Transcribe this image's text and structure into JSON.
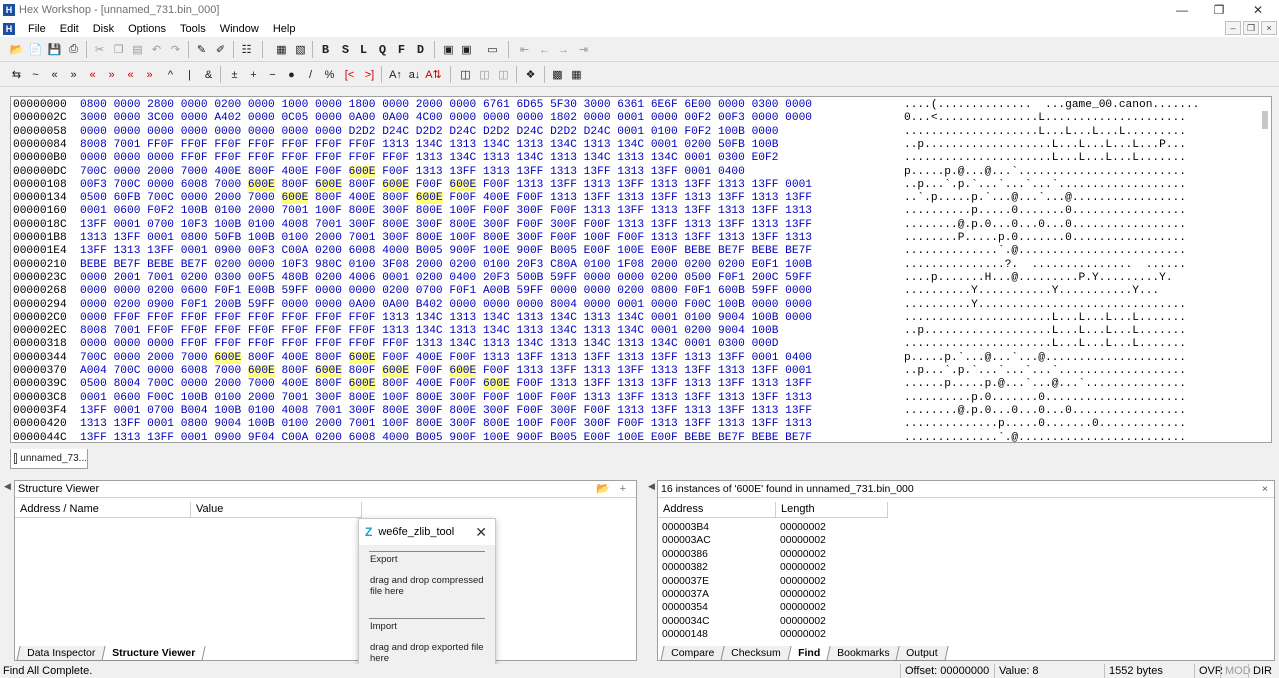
{
  "window": {
    "title": "Hex Workshop - [unnamed_731.bin_000]",
    "app_icon": "H"
  },
  "menu": [
    "File",
    "Edit",
    "Disk",
    "Options",
    "Tools",
    "Window",
    "Help"
  ],
  "toolbar2_letters": [
    "B",
    "S",
    "L",
    "Q",
    "F",
    "D"
  ],
  "hex_rows": [
    {
      "off": "00000000",
      "bytes": "0800 0000 2800 0000 0200 0000 1000 0000 1800 0000 2000 0000 6761 6D65 5F30 3000 6361 6E6F 6E00 0000 0300 0000",
      "ascii": "....(..............  ...game_00.canon.......",
      "hl": []
    },
    {
      "off": "0000002C",
      "bytes": "3000 0000 3C00 0000 A402 0000 0C05 0000 0A00 0A00 4C00 0000 0000 0000 1802 0000 0001 0000 00F2 00F3 0000 0000",
      "ascii": "0...<...............L.....................",
      "hl": []
    },
    {
      "off": "00000058",
      "bytes": "0000 0000 0000 0000 0000 0000 0000 0000 D2D2 D24C D2D2 D24C D2D2 D24C D2D2 D24C 0001 0100 F0F2 100B 0000",
      "ascii": "....................L...L...L...L.........",
      "hl": []
    },
    {
      "off": "00000084",
      "bytes": "8008 7001 FF0F FF0F FF0F FF0F FF0F FF0F FF0F 1313 134C 1313 134C 1313 134C 1313 134C 0001 0200 50FB 100B",
      "ascii": "..p...................L...L...L...L...P...",
      "hl": []
    },
    {
      "off": "000000B0",
      "bytes": "0000 0000 0000 FF0F FF0F FF0F FF0F FF0F FF0F FF0F 1313 134C 1313 134C 1313 134C 1313 134C 0001 0300 E0F2",
      "ascii": "......................L...L...L...L.......",
      "hl": []
    },
    {
      "off": "000000DC",
      "bytes": "700C 0000 2000 7000 400E 800F 400E F00F 600E F00F 1313 13FF 1313 13FF 1313 13FF 1313 13FF 0001 0400",
      "ascii": "p.....p.@...@...`.........................",
      "hl": [
        8
      ]
    },
    {
      "off": "00000108",
      "bytes": "00F3 700C 0000 6008 7000 600E 800F 600E 800F 600E F00F 600E F00F 1313 13FF 1313 13FF 1313 13FF 1313 13FF 0001",
      "ascii": "..p...`.p.`...`...`...`...................",
      "hl": [
        5,
        7,
        9,
        11
      ]
    },
    {
      "off": "00000134",
      "bytes": "0500 60FB 700C 0000 2000 7000 600E 800F 400E 800F 600E F00F 400E F00F 1313 13FF 1313 13FF 1313 13FF 1313 13FF",
      "ascii": "..`.p.....p.`...@...`...@.................",
      "hl": [
        6,
        10
      ]
    },
    {
      "off": "00000160",
      "bytes": "0001 0600 F0F2 100B 0100 2000 7001 100F 800E 300F 800E 100F F00F 300F F00F 1313 13FF 1313 13FF 1313 13FF 1313",
      "ascii": "..........p.....0.......0.................",
      "hl": []
    },
    {
      "off": "0000018C",
      "bytes": "13FF 0001 0700 10F3 100B 0100 4008 7001 300F 800E 300F 800E 300F F00F 300F F00F 1313 13FF 1313 13FF 1313 13FF",
      "ascii": "........@.p.0...0...0...0.................",
      "hl": []
    },
    {
      "off": "000001B8",
      "bytes": "1313 13FF 0001 0800 50FB 100B 0100 2000 7001 300F 800E 100F 800E 300F F00F 100F F00F 1313 13FF 1313 13FF 1313",
      "ascii": "........P.....p.0.......0.................",
      "hl": []
    },
    {
      "off": "000001E4",
      "bytes": "13FF 1313 13FF 0001 0900 00F3 C00A 0200 6008 4000 B005 900F 100E 900F B005 E00F 100E E00F BEBE BE7F BEBE BE7F",
      "ascii": "..............`.@.........................",
      "hl": []
    },
    {
      "off": "00000210",
      "bytes": "BEBE BE7F BEBE BE7F 0200 0000 10F3 980C 0100 3F08 2000 0200 0100 20F3 C80A 0100 1F08 2000 0200 0200 E0F1 100B",
      "ascii": "...............?.  ...............  ......",
      "hl": []
    },
    {
      "off": "0000023C",
      "bytes": "0000 2001 7001 0200 0300 00F5 480B 0200 4006 0001 0200 0400 20F3 500B 59FF 0000 0000 0200 0500 F0F1 200C 59FF",
      "ascii": "....p.......H...@.........P.Y.........Y.",
      "hl": []
    },
    {
      "off": "00000268",
      "bytes": "0000 0000 0200 0600 F0F1 E00B 59FF 0000 0000 0200 0700 F0F1 A00B 59FF 0000 0000 0200 0800 F0F1 600B 59FF 0000",
      "ascii": "..........Y...........Y...........Y...",
      "hl": []
    },
    {
      "off": "00000294",
      "bytes": "0000 0200 0900 F0F1 200B 59FF 0000 0000 0A00 0A00 B402 0000 0000 0000 8004 0000 0001 0000 F00C 100B 0000 0000",
      "ascii": "..........Y...............................",
      "hl": []
    },
    {
      "off": "000002C0",
      "bytes": "0000 FF0F FF0F FF0F FF0F FF0F FF0F FF0F FF0F 1313 134C 1313 134C 1313 134C 1313 134C 0001 0100 9004 100B 0000",
      "ascii": "......................L...L...L...L.......",
      "hl": []
    },
    {
      "off": "000002EC",
      "bytes": "8008 7001 FF0F FF0F FF0F FF0F FF0F FF0F FF0F 1313 134C 1313 134C 1313 134C 1313 134C 0001 0200 9004 100B",
      "ascii": "..p...................L...L...L...L.......",
      "hl": []
    },
    {
      "off": "00000318",
      "bytes": "0000 0000 0000 FF0F FF0F FF0F FF0F FF0F FF0F FF0F 1313 134C 1313 134C 1313 134C 1313 134C 0001 0300 000D",
      "ascii": "......................L...L...L...L.......",
      "hl": []
    },
    {
      "off": "00000344",
      "bytes": "700C 0000 2000 7000 600E 800F 400E 800F 600E F00F 400E F00F 1313 13FF 1313 13FF 1313 13FF 1313 13FF 0001 0400",
      "ascii": "p.....p.`...@...`...@.....................",
      "hl": [
        4,
        8
      ]
    },
    {
      "off": "00000370",
      "bytes": "A004 700C 0000 6008 7000 600E 800F 600E 800F 600E F00F 600E F00F 1313 13FF 1313 13FF 1313 13FF 1313 13FF 0001",
      "ascii": "..p...`.p.`...`...`...`...................",
      "hl": [
        5,
        7,
        9,
        11
      ]
    },
    {
      "off": "0000039C",
      "bytes": "0500 8004 700C 0000 2000 7000 400E 800F 600E 800F 400E F00F 600E F00F 1313 13FF 1313 13FF 1313 13FF 1313 13FF",
      "ascii": "......p.....p.@...`...@...`...............",
      "hl": [
        8,
        12
      ]
    },
    {
      "off": "000003C8",
      "bytes": "0001 0600 F00C 100B 0100 2000 7001 300F 800E 100F 800E 300F F00F 100F F00F 1313 13FF 1313 13FF 1313 13FF 1313",
      "ascii": "..........p.0.......0.....................",
      "hl": []
    },
    {
      "off": "000003F4",
      "bytes": "13FF 0001 0700 B004 100B 0100 4008 7001 300F 800E 300F 800E 300F F00F 300F F00F 1313 13FF 1313 13FF 1313 13FF",
      "ascii": "........@.p.0...0...0...0.................",
      "hl": []
    },
    {
      "off": "00000420",
      "bytes": "1313 13FF 0001 0800 9004 100B 0100 2000 7001 100F 800E 300F 800E 100F F00F 300F F00F 1313 13FF 1313 13FF 1313",
      "ascii": "..............p.....0.......0.............",
      "hl": []
    },
    {
      "off": "0000044C",
      "bytes": "13FF 1313 13FF 0001 0900 9F04 C00A 0200 6008 4000 B005 900F 100E 900F B005 E00F 100E E00F BEBE BE7F BEBE BE7F",
      "ascii": "..............`.@.........................",
      "hl": []
    }
  ],
  "doc_tab": "unnamed_73...",
  "structure_viewer": {
    "title": "Structure Viewer",
    "col_address": "Address / Name",
    "col_value": "Value",
    "tabs": [
      "Data Inspector",
      "Structure Viewer"
    ]
  },
  "find_panel": {
    "title": "16 instances of '600E' found in unnamed_731.bin_000",
    "col_address": "Address",
    "col_length": "Length",
    "rows": [
      {
        "address": "000003B4",
        "length": "00000002"
      },
      {
        "address": "000003AC",
        "length": "00000002"
      },
      {
        "address": "00000386",
        "length": "00000002"
      },
      {
        "address": "00000382",
        "length": "00000002"
      },
      {
        "address": "0000037E",
        "length": "00000002"
      },
      {
        "address": "0000037A",
        "length": "00000002"
      },
      {
        "address": "00000354",
        "length": "00000002"
      },
      {
        "address": "0000034C",
        "length": "00000002"
      },
      {
        "address": "00000148",
        "length": "00000002"
      }
    ],
    "tabs": [
      "Compare",
      "Checksum",
      "Find",
      "Bookmarks",
      "Output"
    ]
  },
  "popup": {
    "title": "we6fe_zlib_tool",
    "export_label": "Export",
    "export_hint": "drag and drop compressed file here",
    "import_label": "Import",
    "import_hint": "drag and drop exported file here"
  },
  "status": {
    "message": "Find All Complete.",
    "offset": "Offset: 00000000",
    "value": "Value: 8",
    "size": "1552 bytes",
    "ovr": "OVR",
    "mod": "MOD",
    "dir": "DIR"
  }
}
